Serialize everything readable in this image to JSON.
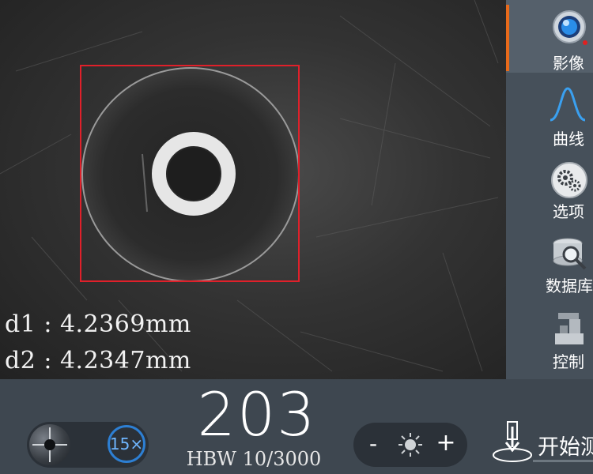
{
  "viewport": {
    "d1": "d1 : 4.2369mm",
    "d2": "d2 : 4.2347mm"
  },
  "sidebar": {
    "items": [
      {
        "label": "影像",
        "icon": "camera-lens-icon",
        "active": true
      },
      {
        "label": "曲线",
        "icon": "curve-icon",
        "active": false
      },
      {
        "label": "选项",
        "icon": "gears-icon",
        "active": false
      },
      {
        "label": "数据库",
        "icon": "database-search-icon",
        "active": false
      },
      {
        "label": "控制",
        "icon": "machine-icon",
        "active": false
      }
    ]
  },
  "bottom": {
    "magnification": "15×",
    "hardness_value": "203",
    "hardness_scale": "HBW 10/3000",
    "brightness_minus": "-",
    "brightness_plus": "+",
    "start_label": "开始测"
  },
  "colors": {
    "accent_orange": "#e86a1a",
    "accent_blue": "#2d7fd3",
    "roi_red": "#e0202a"
  }
}
